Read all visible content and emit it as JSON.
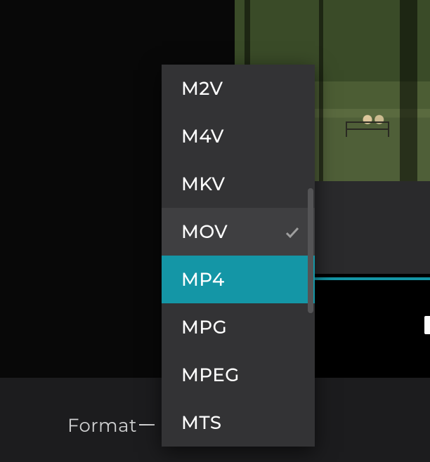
{
  "footer": {
    "label": "Format"
  },
  "dropdown": {
    "items": [
      {
        "value": "M2V",
        "highlighted": false,
        "hovered": false,
        "checked": false
      },
      {
        "value": "M4V",
        "highlighted": false,
        "hovered": false,
        "checked": false
      },
      {
        "value": "MKV",
        "highlighted": false,
        "hovered": false,
        "checked": false
      },
      {
        "value": "MOV",
        "highlighted": false,
        "hovered": true,
        "checked": true
      },
      {
        "value": "MP4",
        "highlighted": true,
        "hovered": false,
        "checked": false
      },
      {
        "value": "MPG",
        "highlighted": false,
        "hovered": false,
        "checked": false
      },
      {
        "value": "MPEG",
        "highlighted": false,
        "hovered": false,
        "checked": false
      },
      {
        "value": "MTS",
        "highlighted": false,
        "hovered": false,
        "checked": false
      }
    ]
  },
  "colors": {
    "accent": "#1496a6"
  }
}
